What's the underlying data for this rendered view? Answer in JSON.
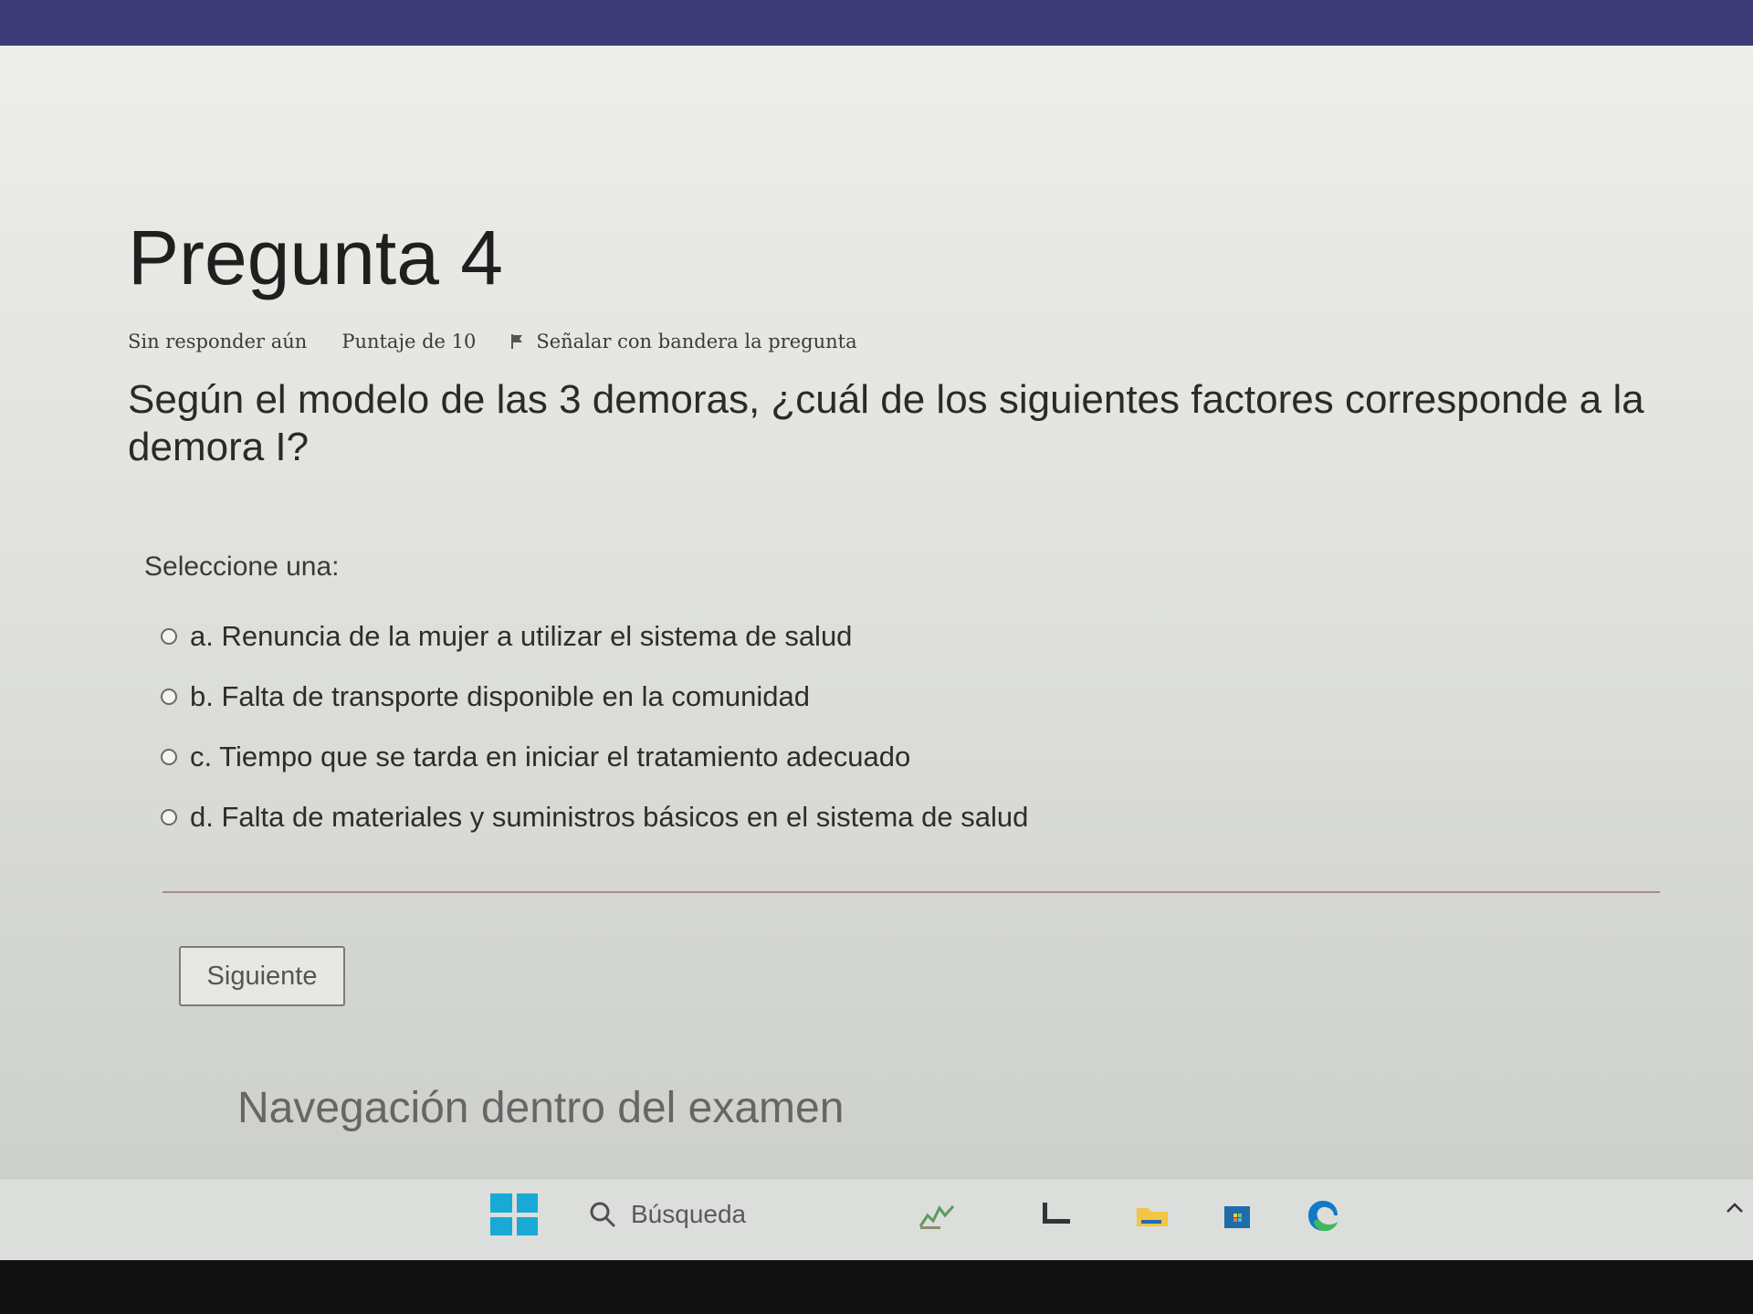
{
  "question": {
    "title": "Pregunta 4",
    "status": "Sin responder aún",
    "points": "Puntaje de 10",
    "flag_label": "Señalar con bandera la pregunta",
    "text": "Según el modelo de las 3 demoras, ¿cuál de los siguientes factores corresponde a la demora I?",
    "prompt": "Seleccione una:",
    "answers": [
      {
        "label": "a. Renuncia de la mujer a utilizar el sistema de salud"
      },
      {
        "label": "b. Falta de transporte disponible en la comunidad"
      },
      {
        "label": "c. Tiempo que se tarda en iniciar el tratamiento adecuado"
      },
      {
        "label": "d. Falta de materiales y suministros básicos en el sistema de salud"
      }
    ],
    "next_button": "Siguiente",
    "navigation_title": "Navegación dentro del examen"
  },
  "taskbar": {
    "search_placeholder": "Búsqueda",
    "colors": {
      "windows_blue": "#19a9d6",
      "folder_yellow": "#f4c542",
      "edge_blue": "#1478c8",
      "edge_green": "#42b85b"
    },
    "icons": [
      "windows-start-icon",
      "search-icon",
      "widgets-icon",
      "task-view-icon",
      "file-explorer-icon",
      "store-icon",
      "edge-icon",
      "chevron-up-icon"
    ]
  }
}
